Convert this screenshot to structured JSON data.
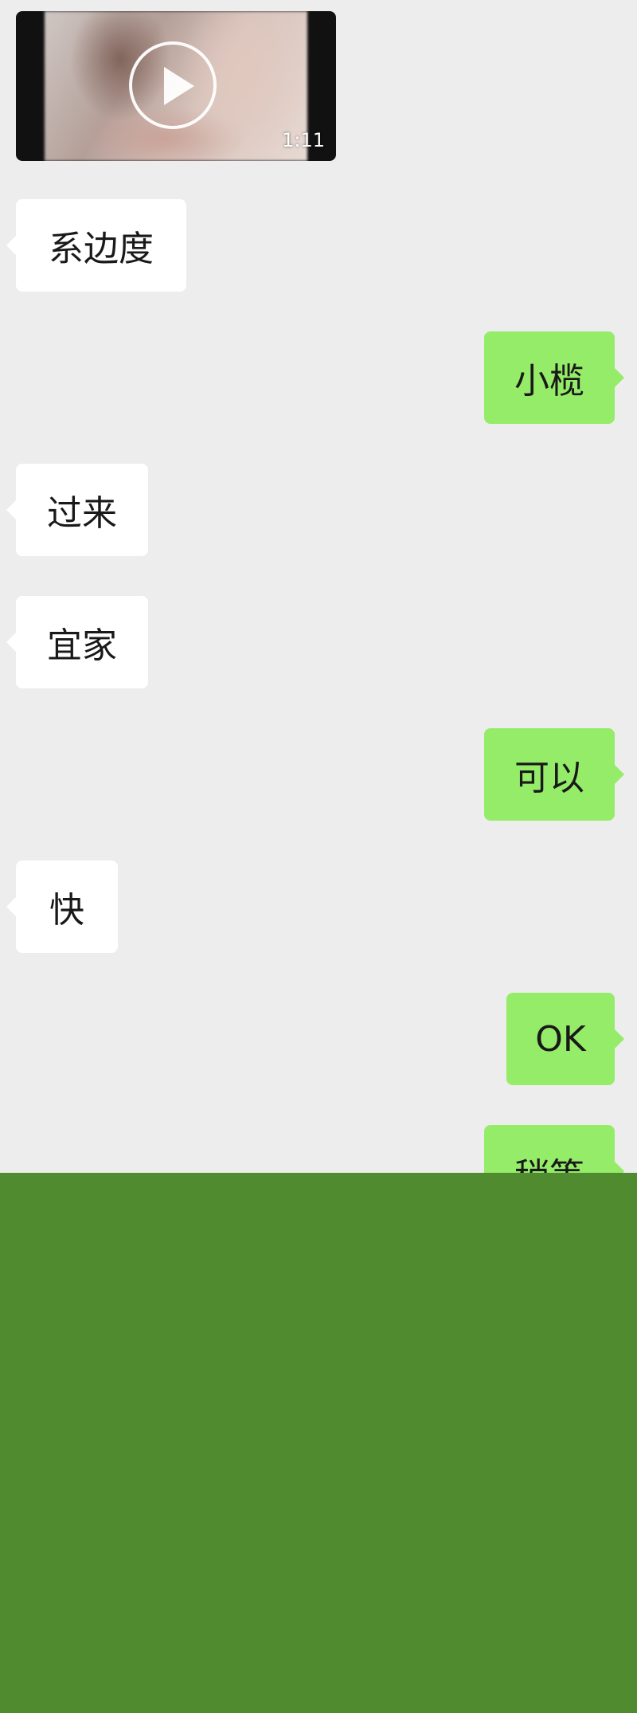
{
  "colors": {
    "chat_background": "#ededed",
    "incoming_bubble": "#ffffff",
    "outgoing_bubble": "#95ec69",
    "cover_block": "#518b2f"
  },
  "video_message": {
    "icon": "play-icon",
    "duration": "1:11"
  },
  "messages": [
    {
      "side": "incoming",
      "text": "系边度"
    },
    {
      "side": "outgoing",
      "text": "小榄"
    },
    {
      "side": "incoming",
      "text": "过来"
    },
    {
      "side": "incoming",
      "text": "宜家"
    },
    {
      "side": "outgoing",
      "text": "可以"
    },
    {
      "side": "incoming",
      "text": "快"
    },
    {
      "side": "outgoing",
      "text": "OK"
    },
    {
      "side": "outgoing",
      "text": "稍等"
    }
  ]
}
